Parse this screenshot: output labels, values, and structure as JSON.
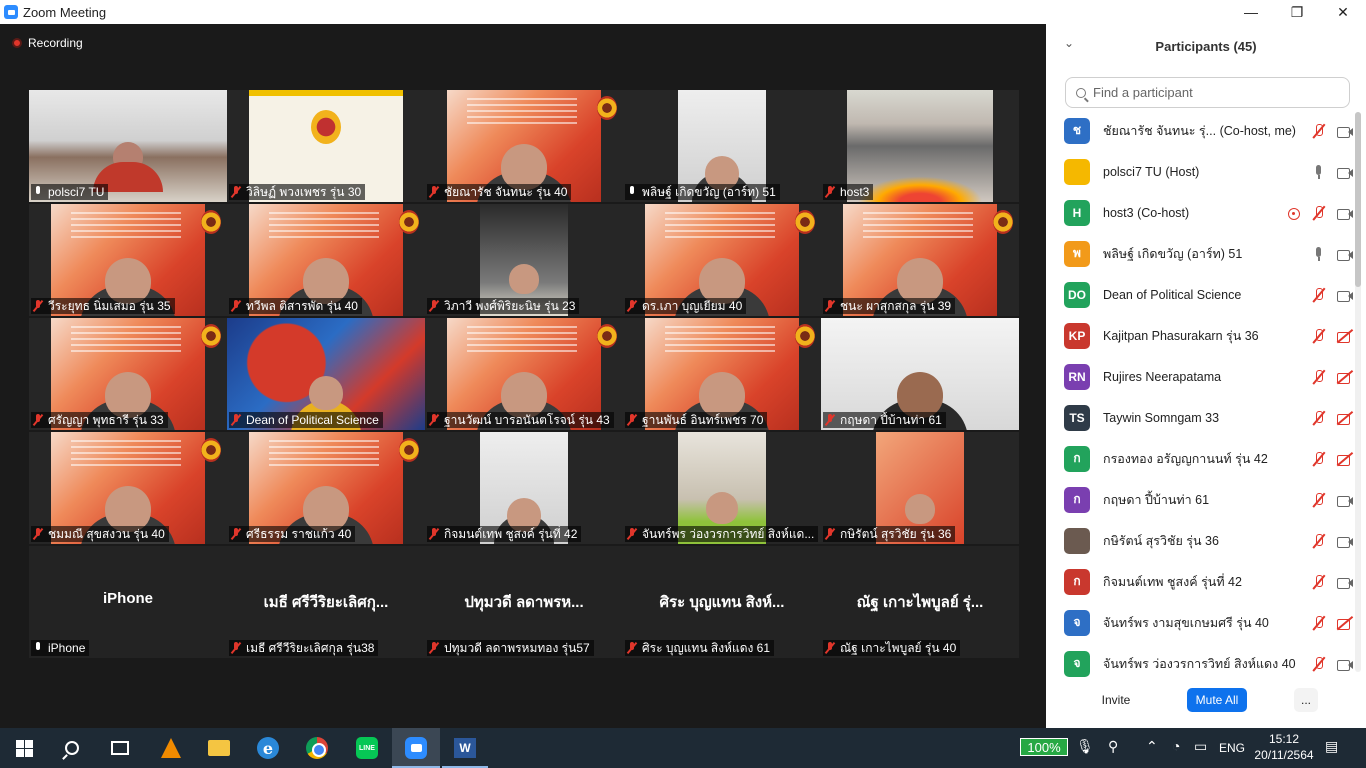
{
  "window": {
    "title": "Zoom Meeting",
    "minimize": "—",
    "maximize": "❐",
    "close": "✕"
  },
  "recording": {
    "label": "Recording"
  },
  "tiles": [
    {
      "name": "polsci7 TU",
      "muted": false,
      "kind": "room"
    },
    {
      "name": "วิลิษฏ์ พวงเพชร รุ่น 30",
      "muted": true,
      "kind": "yellow"
    },
    {
      "name": "ชัยณารัช จันทนะ รุ่น 40",
      "muted": true,
      "kind": "slide-face"
    },
    {
      "name": "พลิษฐ์ เกิดขวัญ (อาร์ท) 51",
      "muted": false,
      "kind": "narrow-white"
    },
    {
      "name": "host3",
      "muted": true,
      "kind": "chair-room"
    },
    {
      "name": "วีระยุทธ นิ่มเสมอ รุ่น 35",
      "muted": true,
      "kind": "slide-face"
    },
    {
      "name": "ทวีพล ติสารพัด รุ่น 40",
      "muted": true,
      "kind": "slide-face"
    },
    {
      "name": "วิภาวี พงศ์พิริยะนิษ รุ่น 23",
      "muted": true,
      "kind": "narrow-dark"
    },
    {
      "name": "ดร.เภา บุญเยียม 40",
      "muted": true,
      "kind": "slide-face"
    },
    {
      "name": "ชนะ ผาสุกสกุล รุ่น 39",
      "muted": true,
      "kind": "slide-face"
    },
    {
      "name": "ศรัญญา พุทธารี รุ่น 33",
      "muted": true,
      "kind": "slide-face"
    },
    {
      "name": "Dean of Political Science",
      "muted": true,
      "kind": "art"
    },
    {
      "name": "ฐานวัฒน์ บารอนันตโรจน์ รุ่น 43",
      "muted": true,
      "kind": "slide-face"
    },
    {
      "name": "ฐานพันธ์ อินทร์เพชร 70",
      "muted": true,
      "kind": "slide-face"
    },
    {
      "name": "กฤษดา ปี้บ้านท่า 61",
      "muted": true,
      "kind": "wide-white"
    },
    {
      "name": "ชมมณี สุขสงวน รุ่น 40",
      "muted": true,
      "kind": "slide-face"
    },
    {
      "name": "ศรีธรรม ราชแก้ว 40",
      "muted": true,
      "kind": "slide-face"
    },
    {
      "name": "กิจมนต์เทพ ชูสงค์ รุ่นที่ 42",
      "muted": true,
      "kind": "narrow-white"
    },
    {
      "name": "จันทร์พร ว่องวรการวิทย์ สิงห์แด...",
      "muted": true,
      "kind": "narrow-green"
    },
    {
      "name": "กษิรัตน์ สุรวิชัย รุ่น 36",
      "muted": true,
      "kind": "narrow-red"
    },
    {
      "name": "iPhone",
      "muted": false,
      "big": "iPhone",
      "kind": "blank"
    },
    {
      "name": "เมธี ศรีวีริยะเลิศกุล รุ่น38",
      "muted": true,
      "big": "เมธี ศรีวีริยะเลิศกุ...",
      "kind": "blank"
    },
    {
      "name": "ปทุมวดี ลดาพรหมทอง รุ่น57",
      "muted": true,
      "big": "ปทุมวดี ลดาพรห...",
      "kind": "blank"
    },
    {
      "name": "ศิระ บุญแทน สิงห์แดง 61",
      "muted": true,
      "big": "ศิระ บุญแทน สิงห์...",
      "kind": "blank"
    },
    {
      "name": "ณัฐ เกาะไพบูลย์ รุ่น 40",
      "muted": true,
      "big": "ณัฐ เกาะไพบูลย์ รุ่...",
      "kind": "blank"
    }
  ],
  "participants": {
    "title": "Participants (45)",
    "search_placeholder": "Find a participant",
    "list": [
      {
        "initials": "ช",
        "color": "#2e6fc5",
        "name": "ชัยณารัช จันทนะ รุ่...",
        "role": "(Co-host, me)",
        "mic": "red",
        "cam": "gray"
      },
      {
        "initials": "",
        "color": "#f5b800",
        "name": "polsci7 TU",
        "role": "(Host)",
        "mic": "gray",
        "cam": "gray"
      },
      {
        "initials": "H",
        "color": "#22a35c",
        "name": "host3",
        "role": "(Co-host)",
        "mic": "red",
        "cam": "gray",
        "share": true
      },
      {
        "initials": "พ",
        "color": "#f29a1a",
        "name": "พลิษฐ์ เกิดขวัญ (อาร์ท) 51",
        "role": "",
        "mic": "gray",
        "cam": "gray"
      },
      {
        "initials": "DO",
        "color": "#22a35c",
        "name": "Dean of Political Science",
        "role": "",
        "mic": "red",
        "cam": "gray"
      },
      {
        "initials": "KP",
        "color": "#c9382e",
        "name": "Kajitpan Phasurakarn รุ่น 36",
        "role": "",
        "mic": "red",
        "cam": "red"
      },
      {
        "initials": "RN",
        "color": "#7a3fb0",
        "name": "Rujires Neerapatama",
        "role": "",
        "mic": "red",
        "cam": "red"
      },
      {
        "initials": "TS",
        "color": "#2f3b48",
        "name": "Taywin Somngam 33",
        "role": "",
        "mic": "red",
        "cam": "red"
      },
      {
        "initials": "ก",
        "color": "#22a35c",
        "name": "กรองทอง อรัญญกานนท์ รุ่น 42",
        "role": "",
        "mic": "red",
        "cam": "red"
      },
      {
        "initials": "ก",
        "color": "#7a3fb0",
        "name": "กฤษดา ปี้บ้านท่า 61",
        "role": "",
        "mic": "red",
        "cam": "gray"
      },
      {
        "initials": "",
        "color": "#6b5a50",
        "name": "กษิรัตน์ สุรวิชัย รุ่น 36",
        "role": "",
        "mic": "red",
        "cam": "gray"
      },
      {
        "initials": "ก",
        "color": "#c9382e",
        "name": "กิจมนต์เทพ ชูสงค์ รุ่นที่ 42",
        "role": "",
        "mic": "red",
        "cam": "gray"
      },
      {
        "initials": "จ",
        "color": "#2e6fc5",
        "name": "จันทร์พร งามสุขเกษมศรี รุ่น 40",
        "role": "",
        "mic": "red",
        "cam": "red"
      },
      {
        "initials": "จ",
        "color": "#22a35c",
        "name": "จันทร์พร ว่องวรการวิทย์ สิงห์แดง 40",
        "role": "",
        "mic": "red",
        "cam": "gray"
      }
    ],
    "invite": "Invite",
    "mute_all": "Mute All",
    "more": "..."
  },
  "taskbar": {
    "battery": "100%",
    "lang": "ENG",
    "time": "15:12",
    "date": "20/11/2564",
    "line_label": "LINE",
    "ie_label": "e",
    "word_label": "W"
  }
}
